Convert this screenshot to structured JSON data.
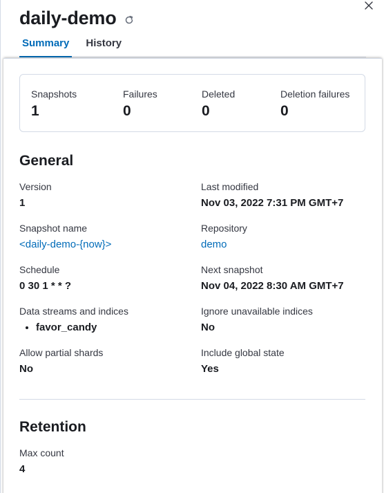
{
  "header": {
    "title": "daily-demo"
  },
  "tabs": [
    {
      "label": "Summary",
      "active": true
    },
    {
      "label": "History",
      "active": false
    }
  ],
  "stats": [
    {
      "label": "Snapshots",
      "value": "1"
    },
    {
      "label": "Failures",
      "value": "0"
    },
    {
      "label": "Deleted",
      "value": "0"
    },
    {
      "label": "Deletion failures",
      "value": "0"
    }
  ],
  "general": {
    "title": "General",
    "version": {
      "label": "Version",
      "value": "1"
    },
    "last_modified": {
      "label": "Last modified",
      "value": "Nov 03, 2022 7:31 PM GMT+7"
    },
    "snapshot_name": {
      "label": "Snapshot name",
      "value": "<daily-demo-{now}>"
    },
    "repository": {
      "label": "Repository",
      "value": "demo"
    },
    "schedule": {
      "label": "Schedule",
      "value": "0 30 1 * * ?"
    },
    "next_snapshot": {
      "label": "Next snapshot",
      "value": "Nov 04, 2022 8:30 AM GMT+7"
    },
    "data_streams": {
      "label": "Data streams and indices",
      "items": [
        "favor_candy"
      ]
    },
    "ignore_unavailable": {
      "label": "Ignore unavailable indices",
      "value": "No"
    },
    "partial_shards": {
      "label": "Allow partial shards",
      "value": "No"
    },
    "global_state": {
      "label": "Include global state",
      "value": "Yes"
    }
  },
  "retention": {
    "title": "Retention",
    "max_count": {
      "label": "Max count",
      "value": "4"
    }
  },
  "colors": {
    "link": "#006bb8",
    "text": "#1a1c21",
    "border": "#d3dae6"
  }
}
